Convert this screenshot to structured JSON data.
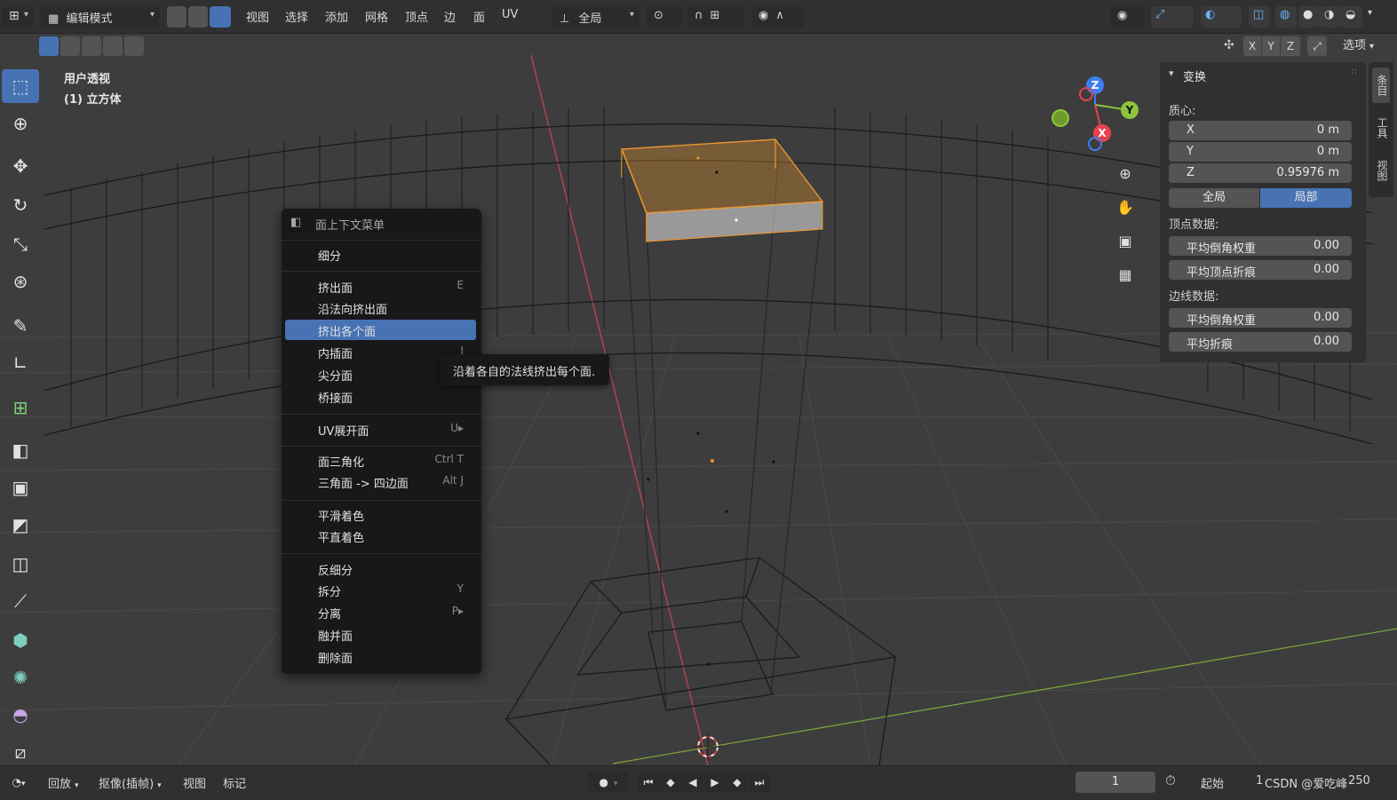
{
  "header": {
    "editor_type_icon": "grid-editor-icon",
    "mode": "编辑模式",
    "menus": [
      "视图",
      "选择",
      "添加",
      "网格",
      "顶点",
      "边",
      "面",
      "UV"
    ],
    "orientation": "全局",
    "options_label": "选项",
    "axes": [
      "X",
      "Y",
      "Z"
    ]
  },
  "viewport": {
    "view_name": "用户透视",
    "object_name": "(1) 立方体"
  },
  "gizmo": {
    "z": "Z",
    "y": "Y",
    "x": "X"
  },
  "npanel": {
    "section_title": "变换",
    "median_label": "质心:",
    "median": [
      {
        "axis": "X",
        "value": "0 m"
      },
      {
        "axis": "Y",
        "value": "0 m"
      },
      {
        "axis": "Z",
        "value": "0.95976 m"
      }
    ],
    "space_global": "全局",
    "space_local": "局部",
    "vertex_data_label": "顶点数据:",
    "vertex_fields": [
      {
        "label": "平均倒角权重",
        "value": "0.00"
      },
      {
        "label": "平均顶点折痕",
        "value": "0.00"
      }
    ],
    "edge_data_label": "边线数据:",
    "edge_fields": [
      {
        "label": "平均倒角权重",
        "value": "0.00"
      },
      {
        "label": "平均折痕",
        "value": "0.00"
      }
    ],
    "side_tabs": [
      "条目",
      "工具",
      "视图"
    ]
  },
  "context_menu": {
    "title": "面上下文菜单",
    "items": [
      {
        "label": "细分",
        "shortcut": ""
      },
      {
        "label": "挤出面",
        "shortcut": "E"
      },
      {
        "label": "沿法向挤出面",
        "shortcut": ""
      },
      {
        "label": "挤出各个面",
        "shortcut": ""
      },
      {
        "label": "内插面",
        "shortcut": "I"
      },
      {
        "label": "尖分面",
        "shortcut": ""
      },
      {
        "label": "桥接面",
        "shortcut": ""
      },
      {
        "label": "UV展开面",
        "shortcut": "U▸"
      },
      {
        "label": "面三角化",
        "shortcut": "Ctrl T"
      },
      {
        "label": "三角面 -> 四边面",
        "shortcut": "Alt J"
      },
      {
        "label": "平滑着色",
        "shortcut": ""
      },
      {
        "label": "平直着色",
        "shortcut": ""
      },
      {
        "label": "反细分",
        "shortcut": ""
      },
      {
        "label": "拆分",
        "shortcut": "Y"
      },
      {
        "label": "分离",
        "shortcut": "P▸"
      },
      {
        "label": "融并面",
        "shortcut": ""
      },
      {
        "label": "删除面",
        "shortcut": ""
      }
    ],
    "tooltip": "沿着各自的法线挤出每个面."
  },
  "timeline": {
    "playback": "回放",
    "keying": "抠像(插帧)",
    "view": "视图",
    "marker": "标记",
    "current_frame": "1",
    "start_label": "起始",
    "start_value": "1",
    "watermark": "CSDN @爱吃峰",
    "end_value": "250"
  },
  "colors": {
    "accent": "#4772b3",
    "selection_orange": "#e8952e",
    "axis_x": "#e8414e",
    "axis_y": "#8ac53b",
    "axis_z": "#3d7ff0"
  }
}
